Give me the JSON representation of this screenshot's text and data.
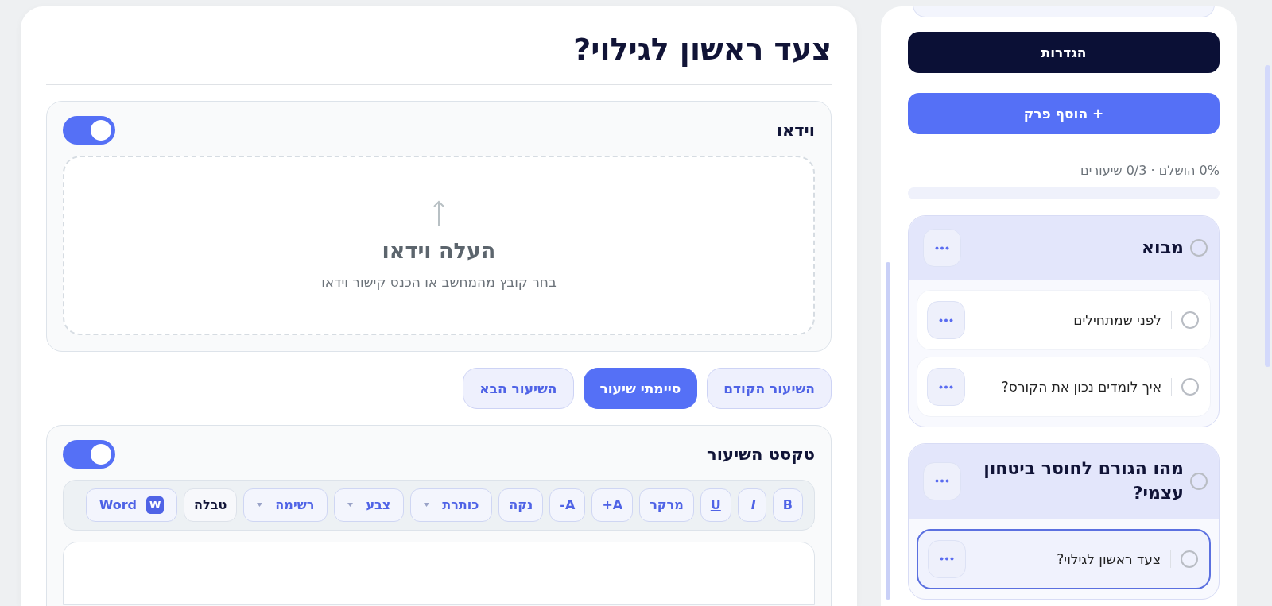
{
  "lesson": {
    "title": "צעד ראשון לגילוי?"
  },
  "video": {
    "label": "וידאו",
    "on": true,
    "upload_title": "העלה וידאו",
    "upload_hint": "בחר קובץ מהמחשב או הכנס קישור וידאו"
  },
  "nav_buttons": [
    {
      "label": "השיעור הקודם",
      "selected": false
    },
    {
      "label": "סיימתי שיעור",
      "selected": true
    },
    {
      "label": "השיעור הבא",
      "selected": false
    }
  ],
  "text_section": {
    "label": "טקסט השיעור",
    "on": true
  },
  "toolbar": [
    {
      "kind": "bold",
      "label": "B"
    },
    {
      "kind": "italic",
      "label": "I"
    },
    {
      "kind": "underline",
      "label": "U"
    },
    {
      "kind": "text",
      "label": "מרקר"
    },
    {
      "kind": "text",
      "label": "A+"
    },
    {
      "kind": "text",
      "label": "A-"
    },
    {
      "kind": "text",
      "label": "נקה"
    },
    {
      "kind": "dropdown",
      "label": "כותרת"
    },
    {
      "kind": "dropdown",
      "label": "צבע"
    },
    {
      "kind": "dropdown",
      "label": "רשימה"
    },
    {
      "kind": "strong",
      "label": "טבלה"
    },
    {
      "kind": "import",
      "label": "Word",
      "badge": "W"
    }
  ],
  "sidebar": {
    "settings_button": "הגדרות",
    "add_chapter_button": "+ הוסף פרק",
    "progress_text": "0% הושלם · 0/3 שיעורים",
    "progress": {
      "level": 0
    },
    "chapters": [
      {
        "title": "מבוא",
        "completed": false,
        "lessons": [
          {
            "title": "לפני שמתחילים",
            "completed": false,
            "selected": false
          },
          {
            "title": "איך לומדים נכון את הקורס?",
            "completed": false,
            "selected": false
          }
        ]
      },
      {
        "title": "מהו הגורם לחוסר ביטחון עצמי?",
        "completed": false,
        "lessons": [
          {
            "title": "צעד ראשון לגילוי?",
            "completed": false,
            "selected": true
          }
        ]
      }
    ]
  }
}
